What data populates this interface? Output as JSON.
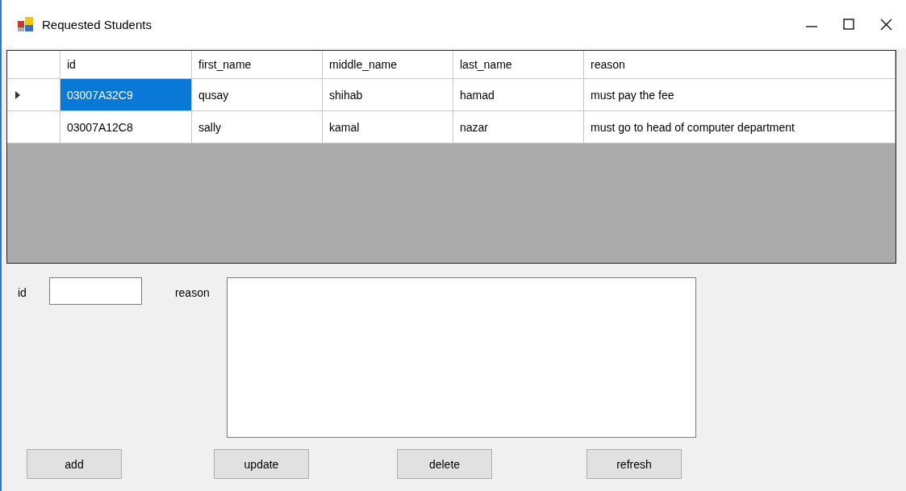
{
  "window": {
    "title": "Requested Students"
  },
  "table": {
    "columns": [
      "id",
      "first_name",
      "middle_name",
      "last_name",
      "reason"
    ],
    "rows": [
      {
        "selected": true,
        "cells": [
          "03007A32C9",
          "qusay",
          "shihab",
          "hamad",
          "must pay the fee"
        ]
      },
      {
        "selected": false,
        "cells": [
          "03007A12C8",
          "sally",
          "kamal",
          "nazar",
          "must go to head of computer department"
        ]
      }
    ]
  },
  "form": {
    "id_label": "id",
    "reason_label": "reason"
  },
  "buttons": [
    "add",
    "update",
    "delete",
    "refresh"
  ]
}
